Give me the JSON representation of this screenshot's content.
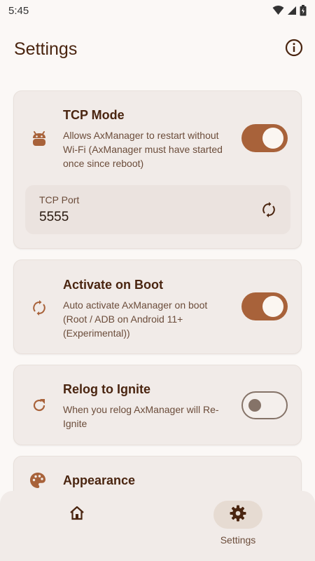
{
  "status_bar": {
    "time": "5:45"
  },
  "header": {
    "title": "Settings",
    "info_icon": "info-icon"
  },
  "tcp_card": {
    "title": "TCP Mode",
    "description": "Allows AxManager to restart without Wi-Fi (AxManager must have started once since reboot)",
    "icon": "android-icon",
    "enabled": true,
    "port": {
      "label": "TCP Port",
      "value": "5555",
      "reset_icon": "reset-icon"
    }
  },
  "boot_card": {
    "title": "Activate on Boot",
    "description": "Auto activate AxManager on boot (Root / ADB on Android 11+ (Experimental))",
    "icon": "sync-icon",
    "enabled": true
  },
  "relog_card": {
    "title": "Relog to Ignite",
    "description": "When you relog AxManager will Re-Ignite",
    "icon": "refresh-icon",
    "enabled": false
  },
  "appearance_card": {
    "title": "Appearance",
    "icon": "palette-icon"
  },
  "bottom_nav": {
    "items": [
      {
        "label": "",
        "icon": "home-icon",
        "active": false
      },
      {
        "label": "Settings",
        "icon": "gear-icon",
        "active": true
      }
    ]
  },
  "colors": {
    "accent": "#a8623a",
    "text_primary": "#4a2510",
    "card_bg": "#f1ebe8",
    "page_bg": "#fbf8f6"
  }
}
